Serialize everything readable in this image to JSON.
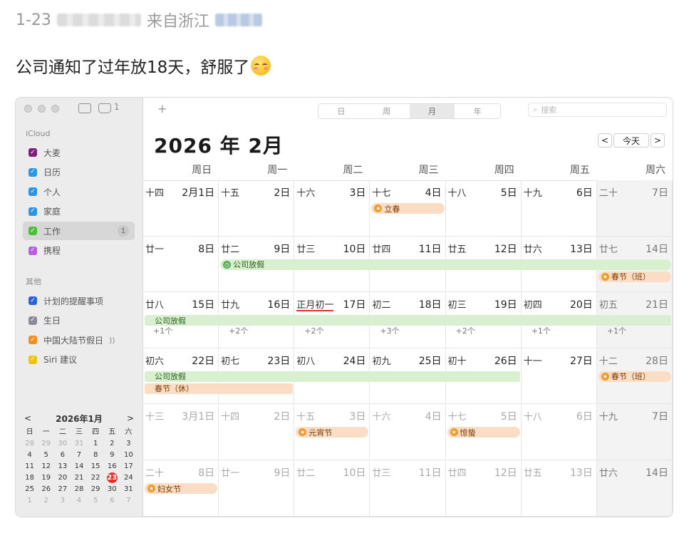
{
  "post": {
    "date": "1-23",
    "from": "来自浙江",
    "text": "公司通知了过年放18天，舒服了"
  },
  "toolbar": {
    "inbox_count": "1",
    "add": "+",
    "views": [
      "日",
      "周",
      "月",
      "年"
    ],
    "active_view": "月",
    "search_placeholder": "搜索"
  },
  "sidebar": {
    "icloud_header": "iCloud",
    "calendars": [
      {
        "label": "大麦",
        "color": "#7d1f7d"
      },
      {
        "label": "日历",
        "color": "#2b95e3"
      },
      {
        "label": "个人",
        "color": "#2b95e3"
      },
      {
        "label": "家庭",
        "color": "#2b95e3"
      },
      {
        "label": "工作",
        "color": "#4cbf3a",
        "badge": "1"
      },
      {
        "label": "携程",
        "color": "#b75de0"
      }
    ],
    "other_header": "其他",
    "others": [
      {
        "label": "计划的提醒事项",
        "color": "#2b63d8"
      },
      {
        "label": "生日",
        "color": "#8a8a99"
      },
      {
        "label": "中国大陆节假日",
        "color": "#f28e1c",
        "extra": "))"
      },
      {
        "label": "Siri 建议",
        "color": "#f2c20b"
      }
    ]
  },
  "mini_calendar": {
    "title": "2026年1月",
    "prev": "<",
    "next": ">",
    "weekdays": [
      "日",
      "一",
      "二",
      "三",
      "四",
      "五",
      "六"
    ],
    "weeks": [
      [
        "28",
        "29",
        "30",
        "31",
        "1",
        "2",
        "3"
      ],
      [
        "4",
        "5",
        "6",
        "7",
        "8",
        "9",
        "10"
      ],
      [
        "11",
        "12",
        "13",
        "14",
        "15",
        "16",
        "17"
      ],
      [
        "18",
        "19",
        "20",
        "21",
        "22",
        "23",
        "24"
      ],
      [
        "25",
        "26",
        "27",
        "28",
        "29",
        "30",
        "31"
      ],
      [
        "1",
        "2",
        "3",
        "4",
        "5",
        "6",
        "7"
      ]
    ],
    "today": "23"
  },
  "calendar": {
    "title": "2026 年 2月",
    "nav_prev": "<",
    "today_label": "今天",
    "nav_next": ">",
    "weekdays": [
      "周日",
      "周一",
      "周二",
      "周三",
      "周四",
      "周五",
      "周六"
    ],
    "weeks": [
      [
        [
          "十四",
          "2月1日"
        ],
        [
          "十五",
          "2日"
        ],
        [
          "十六",
          "3日"
        ],
        [
          "十七",
          "4日"
        ],
        [
          "十八",
          "5日"
        ],
        [
          "十九",
          "6日"
        ],
        [
          "二十",
          "7日"
        ]
      ],
      [
        [
          "廿一",
          "8日"
        ],
        [
          "廿二",
          "9日"
        ],
        [
          "廿三",
          "10日"
        ],
        [
          "廿四",
          "11日"
        ],
        [
          "廿五",
          "12日"
        ],
        [
          "廿六",
          "13日"
        ],
        [
          "廿七",
          "14日"
        ]
      ],
      [
        [
          "廿八",
          "15日"
        ],
        [
          "廿九",
          "16日"
        ],
        [
          "正月初一",
          "17日"
        ],
        [
          "初二",
          "18日"
        ],
        [
          "初三",
          "19日"
        ],
        [
          "初四",
          "20日"
        ],
        [
          "初五",
          "21日"
        ]
      ],
      [
        [
          "初六",
          "22日"
        ],
        [
          "初七",
          "23日"
        ],
        [
          "初八",
          "24日"
        ],
        [
          "初九",
          "25日"
        ],
        [
          "初十",
          "26日"
        ],
        [
          "十一",
          "27日"
        ],
        [
          "十二",
          "28日"
        ]
      ],
      [
        [
          "十三",
          "3月1日"
        ],
        [
          "十四",
          "2日"
        ],
        [
          "十五",
          "3日"
        ],
        [
          "十六",
          "4日"
        ],
        [
          "十七",
          "5日"
        ],
        [
          "十八",
          "6日"
        ],
        [
          "十九",
          "7日"
        ]
      ],
      [
        [
          "二十",
          "8日"
        ],
        [
          "廿一",
          "9日"
        ],
        [
          "廿二",
          "10日"
        ],
        [
          "廿三",
          "11日"
        ],
        [
          "廿四",
          "12日"
        ],
        [
          "廿五",
          "13日"
        ],
        [
          "廿六",
          "14日"
        ]
      ]
    ],
    "dim_weeks": [
      4,
      5
    ],
    "more_labels": [
      "+1个",
      "+2个",
      "+2个",
      "+3个",
      "+2个",
      "+1个",
      "+1个"
    ],
    "events": {
      "lichun": "立春",
      "holiday_w2": "公司放假",
      "chunjie_ban": "春节（班）",
      "holiday_w3": "公司放假",
      "holiday_w4": "公司放假",
      "chunjie_xiu": "春节（休）",
      "chunjie_ban2": "春节（班）",
      "yuanxiao": "元宵节",
      "jingzhe": "惊蛰",
      "funv": "妇女节"
    }
  }
}
